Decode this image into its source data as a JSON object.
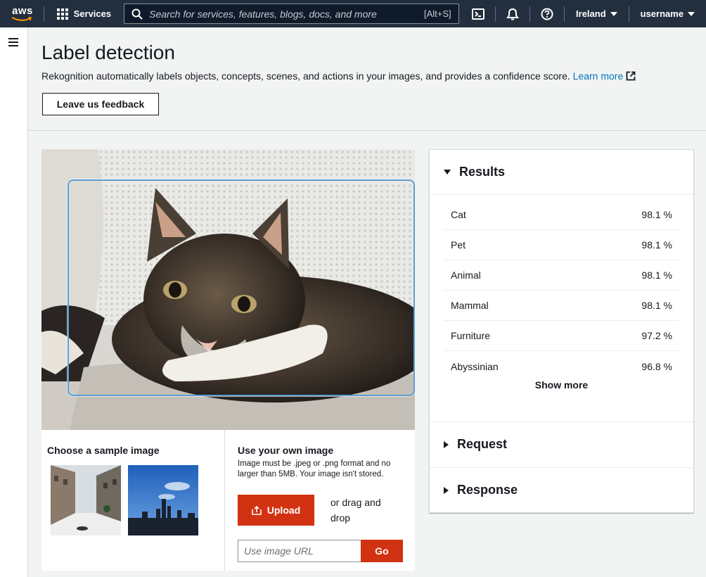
{
  "topnav": {
    "logo_text": "aws",
    "services_label": "Services",
    "search_placeholder": "Search for services, features, blogs, docs, and more",
    "search_shortcut": "[Alt+S]",
    "region": "Ireland",
    "username": "username"
  },
  "header": {
    "title": "Label detection",
    "description": "Rekognition automatically labels objects, concepts, scenes, and actions in your images, and provides a confidence score.",
    "learn_more": "Learn more",
    "feedback_button": "Leave us feedback"
  },
  "sample": {
    "title": "Choose a sample image"
  },
  "own_image": {
    "title": "Use your own image",
    "note": "Image must be .jpeg or .png format and no larger than 5MB. Your image isn't stored.",
    "upload_label": "Upload",
    "drag_text": "or drag and drop",
    "url_placeholder": "Use image URL",
    "go_label": "Go"
  },
  "results": {
    "title": "Results",
    "items": [
      {
        "label": "Cat",
        "confidence": "98.1 %"
      },
      {
        "label": "Pet",
        "confidence": "98.1 %"
      },
      {
        "label": "Animal",
        "confidence": "98.1 %"
      },
      {
        "label": "Mammal",
        "confidence": "98.1 %"
      },
      {
        "label": "Furniture",
        "confidence": "97.2 %"
      },
      {
        "label": "Abyssinian",
        "confidence": "96.8 %"
      }
    ],
    "show_more": "Show more"
  },
  "request": {
    "title": "Request"
  },
  "response": {
    "title": "Response"
  },
  "colors": {
    "nav_bg": "#232f3e",
    "accent_orange": "#d13212",
    "link_blue": "#0073bb",
    "bbox_blue": "#5a9fd4"
  },
  "icons": [
    "menu-icon",
    "grid-icon",
    "search-icon",
    "cloudshell-icon",
    "bell-icon",
    "help-icon",
    "external-link-icon",
    "upload-icon"
  ]
}
